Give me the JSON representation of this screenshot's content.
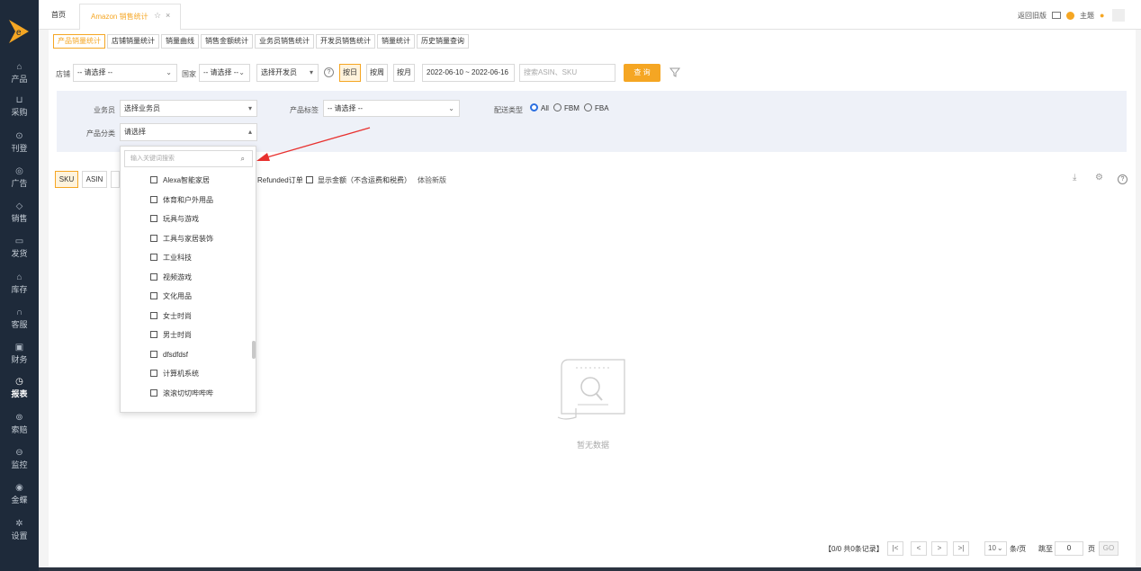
{
  "sidebar": {
    "items": [
      {
        "icon": "box-icon",
        "label": "产品"
      },
      {
        "icon": "cart-icon",
        "label": "采购"
      },
      {
        "icon": "upload-icon",
        "label": "刊登"
      },
      {
        "icon": "megaphone-icon",
        "label": "广告"
      },
      {
        "icon": "tag-icon",
        "label": "销售"
      },
      {
        "icon": "truck-icon",
        "label": "发货"
      },
      {
        "icon": "home-icon",
        "label": "库存"
      },
      {
        "icon": "headset-icon",
        "label": "客服"
      },
      {
        "icon": "wallet-icon",
        "label": "财务"
      },
      {
        "icon": "clock-icon",
        "label": "报表"
      },
      {
        "icon": "settings-icon",
        "label": "索赔"
      },
      {
        "icon": "monitor-icon",
        "label": "监控"
      },
      {
        "icon": "coin-icon",
        "label": "金蝶"
      },
      {
        "icon": "gear-icon",
        "label": "设置"
      }
    ],
    "active_index": 9
  },
  "topbar": {
    "home_tab": "首页",
    "active_tab": "Amazon 销售统计",
    "star": "☆",
    "close": "×",
    "back_old": "返回旧版",
    "theme": "主题"
  },
  "subtabs": [
    "产品销量统计",
    "店铺销量统计",
    "销量曲线",
    "销售金额统计",
    "业务员销售统计",
    "开发员销售统计",
    "销量统计",
    "历史销量查询"
  ],
  "filters": {
    "shop_label": "店铺",
    "shop_value": "-- 请选择 --",
    "country_label": "国家",
    "country_value": "-- 请选择 --",
    "developer_value": "选择开发员",
    "by_day": "按日",
    "by_week": "按周",
    "by_month": "按月",
    "date_range": "2022-06-10 ~ 2022-06-16",
    "search_placeholder": "搜索ASIN、SKU",
    "query": "查 询"
  },
  "advanced": {
    "salesman_label": "业务员",
    "salesman_value": "选择业务员",
    "product_tag_label": "产品标签",
    "product_tag_value": "-- 请选择 --",
    "delivery_label": "配送类型",
    "delivery_all": "All",
    "delivery_fbm": "FBM",
    "delivery_fba": "FBA",
    "category_label": "产品分类",
    "category_value": "请选择"
  },
  "dropdown": {
    "search_placeholder": "输入关键词搜索",
    "items": [
      "Alexa智能家居",
      "体育和户外用品",
      "玩具与游戏",
      "工具与家居装饰",
      "工业科技",
      "视频游戏",
      "文化用品",
      "女士时尚",
      "男士时尚",
      "dfsdfdsf",
      "计算机系统",
      "滚滚切切哔哔哔"
    ]
  },
  "toolbar": {
    "sku": "SKU",
    "asin": "ASIN",
    "refunded": "Refunded订单",
    "show_amount": "显示金额（不含运费和税费）",
    "try_new": "体验新版"
  },
  "empty": {
    "text": "暂无数据"
  },
  "pager": {
    "summary": "【0/0  共0条记录】",
    "first": "|<",
    "prev": "<",
    "next": ">",
    "last": ">|",
    "page_size": "10",
    "per_page": "条/页",
    "goto_label": "跳至",
    "goto_value": "0",
    "page_unit": "页",
    "go": "GO"
  },
  "colors": {
    "accent": "#f5a623",
    "sidebar": "#1e2a3a",
    "red_arrow": "#e8312f"
  }
}
